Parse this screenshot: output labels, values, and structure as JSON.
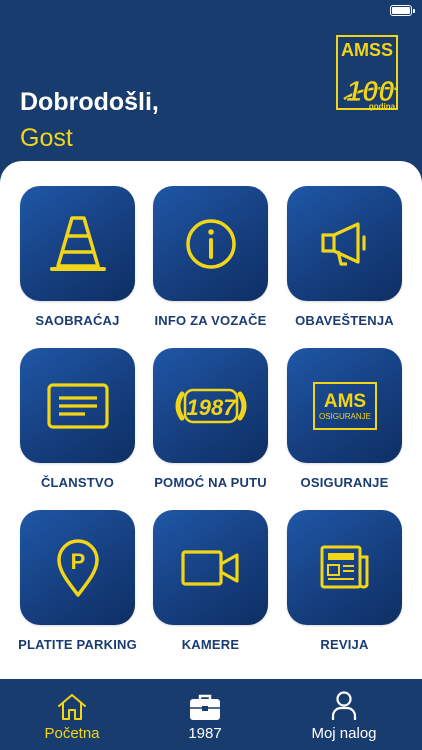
{
  "header": {
    "greeting": "Dobrodošli,",
    "username": "Gost"
  },
  "logo": {
    "brand": "AMSS",
    "anniversary": "100",
    "anniversary_sub": "godina"
  },
  "tiles": [
    {
      "label": "SAOBRAĆAJ",
      "icon": "traffic-cone-icon"
    },
    {
      "label": "INFO ZA VOZAČE",
      "icon": "info-icon"
    },
    {
      "label": "OBAVEŠTENJA",
      "icon": "megaphone-icon"
    },
    {
      "label": "ČLANSTVO",
      "icon": "membership-card-icon"
    },
    {
      "label": "POMOĆ NA PUTU",
      "icon": "roadside-1987-icon",
      "icon_text": "1987"
    },
    {
      "label": "OSIGURANJE",
      "icon": "ams-insurance-icon",
      "icon_text": "AMS",
      "icon_subtext": "OSIGURANJE"
    },
    {
      "label": "PLATITE PARKING",
      "icon": "parking-pin-icon",
      "icon_text": "P"
    },
    {
      "label": "KAMERE",
      "icon": "video-camera-icon"
    },
    {
      "label": "REVIJA",
      "icon": "newspaper-icon"
    }
  ],
  "tabbar": [
    {
      "label": "Početna",
      "icon": "home-icon",
      "active": true
    },
    {
      "label": "1987",
      "icon": "briefcase-icon",
      "active": false
    },
    {
      "label": "Moj nalog",
      "icon": "user-icon",
      "active": false
    }
  ],
  "colors": {
    "background": "#193c6e",
    "accent": "#f2d516",
    "tile": "#1a4a8f",
    "label": "#1a3c72"
  }
}
